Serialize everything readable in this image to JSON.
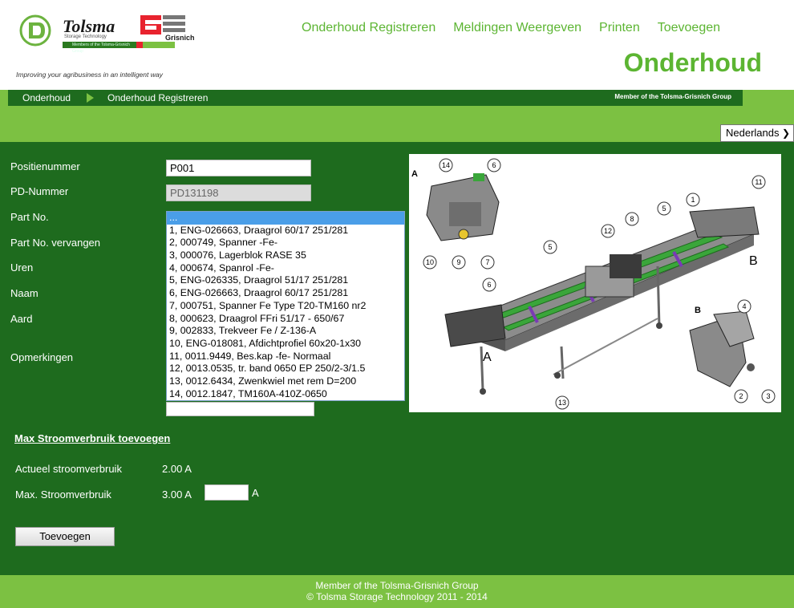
{
  "brand": {
    "name": "Tolsma",
    "name_sub": "Storage Technology",
    "partner": "Grisnich",
    "strip_text": "Members of the Tolsma-Grisnich Group",
    "tagline": "Improving your agribusiness in an intelligent way"
  },
  "nav": {
    "items": [
      "Onderhoud Registreren",
      "Meldingen Weergeven",
      "Printen",
      "Toevoegen"
    ]
  },
  "page_title": "Onderhoud",
  "breadcrumb": {
    "root": "Onderhoud",
    "current": "Onderhoud Registreren",
    "member": "Member of the Tolsma-Grisnich Group"
  },
  "language": "Nederlands",
  "form": {
    "positienummer_label": "Positienummer",
    "positienummer_value": "P001",
    "pd_label": "PD-Nummer",
    "pd_value": "PD131198",
    "partno_label": "Part No.",
    "partno_replaced_label": "Part No. vervangen",
    "uren_label": "Uren",
    "naam_label": "Naam",
    "aard_label": "Aard",
    "opmerkingen_label": "Opmerkingen"
  },
  "part_options": [
    "...",
    "1, ENG-026663, Draagrol 60/17 251/281",
    "2, 000749, Spanner -Fe-",
    "3, 000076, Lagerblok RASE 35",
    "4, 000674, Spanrol -Fe-",
    "5, ENG-026335, Draagrol 51/17 251/281",
    "6, ENG-026663, Draagrol 60/17 251/281",
    "7, 000751, Spanner Fe Type T20-TM160 nr2",
    "8, 000623, Draagrol FFri 51/17 - 650/67",
    "9, 002833, Trekveer Fe / Z-136-A",
    "10, ENG-018081, Afdichtprofiel 60x20-1x30",
    "11, 0011.9449, Bes.kap -fe- Normaal",
    "12, 0013.0535, tr. band 0650 EP 250/2-3/1.5",
    "13, 0012.6434, Zwenkwiel met rem D=200",
    "14, 0012.1847, TM160A-410Z-0650"
  ],
  "diagram": {
    "callouts": [
      "1",
      "2",
      "3",
      "4",
      "5",
      "5",
      "6",
      "6",
      "7",
      "8",
      "9",
      "10",
      "11",
      "12",
      "13",
      "14"
    ],
    "section_labels": [
      "A",
      "A",
      "B",
      "B"
    ]
  },
  "power": {
    "link": "Max Stroomverbruik toevoegen",
    "current_label": "Actueel stroomverbruik",
    "current_value": "2.00 A",
    "max_label": "Max. Stroomverbruik",
    "max_value": "3.00 A",
    "unit": "A",
    "button": "Toevoegen"
  },
  "footer": {
    "line1": "Member of the Tolsma-Grisnich Group",
    "line2": "© Tolsma Storage Technology 2011 - 2014"
  }
}
